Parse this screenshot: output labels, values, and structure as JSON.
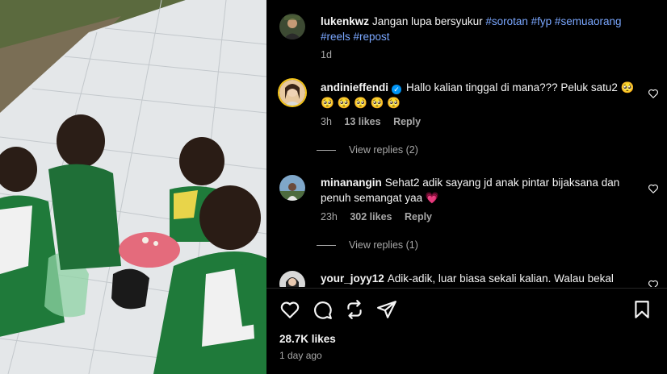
{
  "post": {
    "author": "lukenkwz",
    "caption_text": "Jangan lupa bersyukur ",
    "hashtags_line1": "#sorotan #fyp #semuaorang",
    "hashtags_line2": "#reels #repost",
    "age": "1d"
  },
  "comments": [
    {
      "user": "andinieffendi",
      "verified": true,
      "text_line1": "Hallo kalian tinggal di mana??? Peluk satu2 🥺",
      "text_line2": "🥺 🥺 🥺 🥺 🥺",
      "age": "3h",
      "likes": "13 likes",
      "reply_label": "Reply",
      "view_replies": "View replies (2)"
    },
    {
      "user": "minanangin",
      "verified": false,
      "text_line1": "Sehat2 adik sayang jd anak pintar bijaksana dan",
      "text_line2": "penuh semangat yaa 💗",
      "age": "23h",
      "likes": "302 likes",
      "reply_label": "Reply",
      "view_replies": "View replies (1)"
    },
    {
      "user": "your_joyy12",
      "verified": false,
      "text_line1": "Adik-adik, luar biasa sekali kalian. Walau bekal"
    }
  ],
  "footer": {
    "likes": "28.7K likes",
    "date": "1 day ago"
  },
  "icons": {
    "like": "heart-icon",
    "comment": "comment-bubble-icon",
    "repost": "repost-arrows-icon",
    "share": "paper-plane-icon",
    "save": "bookmark-icon"
  },
  "colors": {
    "background": "#000000",
    "text": "#f5f5f5",
    "muted": "#a8a8a8",
    "hashtag": "#7aa7ff",
    "verified": "#0095f6"
  }
}
